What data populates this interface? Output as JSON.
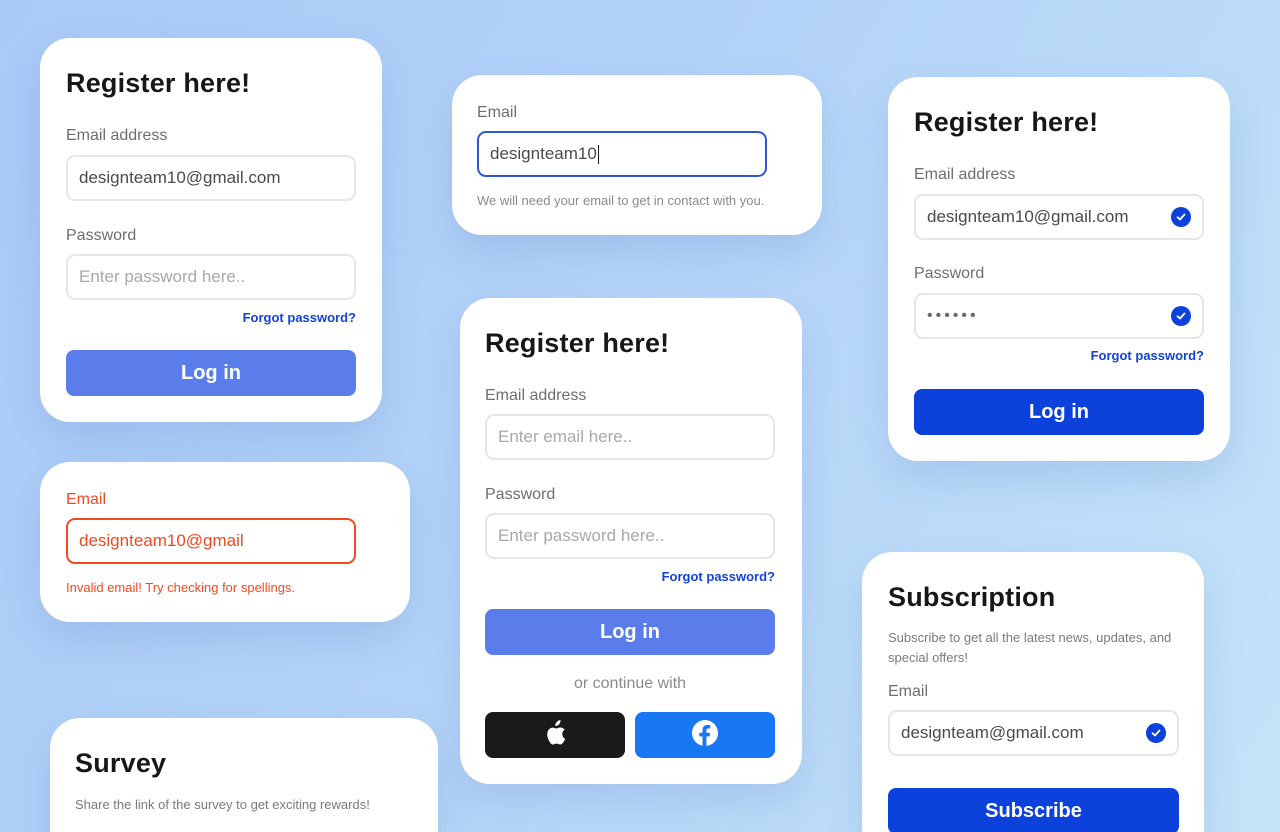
{
  "colors": {
    "primary_light": "#5a7deb",
    "primary_dark": "#0c41dc",
    "link": "#1342d6",
    "error": "#ef4a1f",
    "apple_button": "#1a1a1a",
    "facebook_button": "#1877f2"
  },
  "card_register_1": {
    "title": "Register here!",
    "email_label": "Email address",
    "email_value": "designteam10@gmail.com",
    "password_label": "Password",
    "password_placeholder": "Enter password here..",
    "forgot": "Forgot password?",
    "login": "Log in"
  },
  "card_email_focus": {
    "label": "Email",
    "value": "designteam10",
    "hint": "We will need your email to get in contact with you."
  },
  "card_register_2": {
    "title": "Register here!",
    "email_label": "Email address",
    "email_value": "designteam10@gmail.com",
    "password_label": "Password",
    "password_value": "••••••",
    "forgot": "Forgot password?",
    "login": "Log in"
  },
  "card_email_error": {
    "label": "Email",
    "value": "designteam10@gmail",
    "error": "Invalid email! Try checking for spellings."
  },
  "card_register_3": {
    "title": "Register here!",
    "email_label": "Email address",
    "email_placeholder": "Enter email here..",
    "password_label": "Password",
    "password_placeholder": "Enter password here..",
    "forgot": "Forgot password?",
    "login": "Log in",
    "continue_text": "or continue with",
    "social": [
      "apple-icon",
      "facebook-icon"
    ]
  },
  "card_subscription": {
    "title": "Subscription",
    "description": "Subscribe to get all the latest news, updates, and special offers!",
    "email_label": "Email",
    "email_value": "designteam@gmail.com",
    "subscribe": "Subscribe"
  },
  "card_survey": {
    "title": "Survey",
    "description": "Share the link of the survey to get exciting rewards!"
  }
}
